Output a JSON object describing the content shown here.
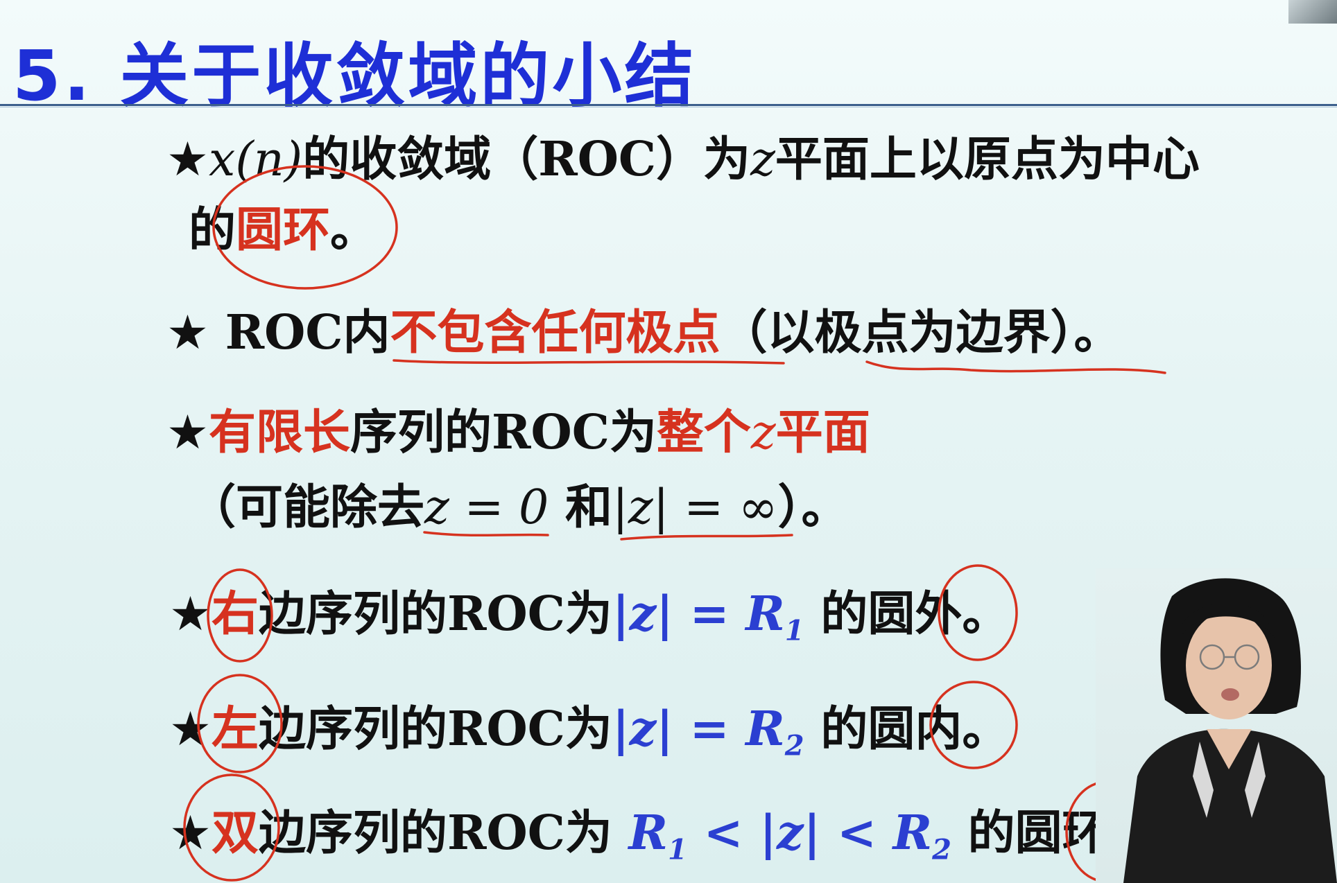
{
  "title": "5. 关于收敛域的小结",
  "bullets": {
    "b1": {
      "star": "★",
      "var_x": "x",
      "paren_open": "(",
      "var_n": "n",
      "paren_close": ")",
      "text1": "的收敛域（ROC）为",
      "var_z": "z",
      "text2": "平面上以原点为中心",
      "line2_text": "的",
      "red_text": "圆环",
      "end": "。"
    },
    "b2": {
      "star": "★",
      "text1": " ROC内",
      "red_text": "不包含任何极点",
      "text2": "（以极点为边界）。"
    },
    "b3": {
      "star": "★",
      "red1": "有限长",
      "text1": "序列的ROC为",
      "red2": "整个",
      "var_z": "z",
      "red3": "平面",
      "line2_text1": "（可能除去",
      "expr1": "z = 0",
      "line2_text2": " 和",
      "expr2": "|z| = ∞",
      "line2_text3": "）。"
    },
    "b4": {
      "star": "★",
      "red_text": "右",
      "text1": "边序列的ROC为",
      "expr": "|z| = R",
      "sub": "1",
      "text2": " 的圆外。"
    },
    "b5": {
      "star": "★",
      "red_text": "左",
      "text1": "边序列的ROC为",
      "expr": "|z| = R",
      "sub": "2",
      "text2": " 的圆内。"
    },
    "b6": {
      "star": "★",
      "red_text": "双",
      "text1": "边序列的ROC为 ",
      "expr_a": "R",
      "sub_a": "1",
      "expr_b": " < |z| < R",
      "sub_b": "2",
      "text2": " 的圆环。"
    }
  },
  "colors": {
    "title": "#1e2fd6",
    "emphasis_red": "#d6321f",
    "math_blue": "#2b3fd1"
  }
}
